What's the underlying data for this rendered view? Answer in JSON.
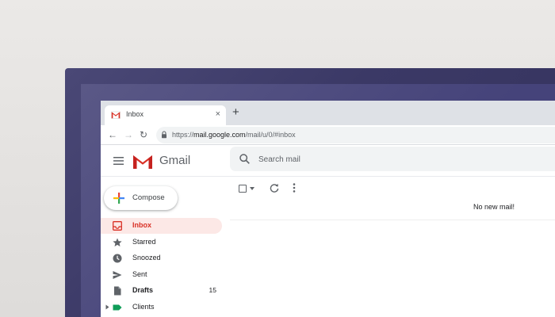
{
  "tab": {
    "title": "Inbox",
    "close_glyph": "×",
    "new_tab_glyph": "+"
  },
  "address_bar": {
    "back_glyph": "←",
    "forward_glyph": "→",
    "reload_glyph": "↻",
    "url_prefix": "https://",
    "url_host": "mail.google.com",
    "url_path": "/mail/u/0/#inbox"
  },
  "header": {
    "product_name": "Gmail",
    "search_placeholder": "Search mail"
  },
  "compose": {
    "label": "Compose"
  },
  "sidebar": {
    "items": [
      {
        "label": "Inbox",
        "icon": "inbox-icon",
        "active": true
      },
      {
        "label": "Starred",
        "icon": "star-icon"
      },
      {
        "label": "Snoozed",
        "icon": "clock-icon"
      },
      {
        "label": "Sent",
        "icon": "send-icon"
      },
      {
        "label": "Drafts",
        "icon": "draft-icon",
        "count": "15"
      },
      {
        "label": "Clients",
        "icon": "label-icon"
      }
    ]
  },
  "main": {
    "empty_message": "No new mail!"
  },
  "colors": {
    "brand_red": "#d93025",
    "active_bg": "#fce8e6",
    "label_green": "#0f9d58"
  }
}
